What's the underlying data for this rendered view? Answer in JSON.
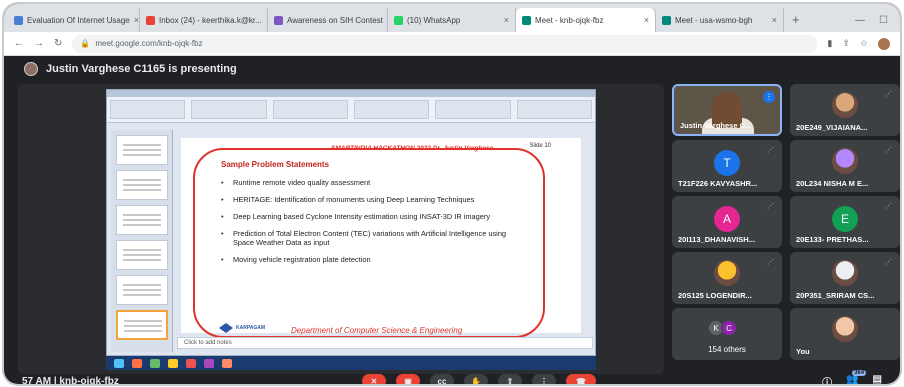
{
  "browser": {
    "tabs": [
      {
        "label": "Evaluation Of Internet Usage",
        "color": "#4a7fd4"
      },
      {
        "label": "Inbox (24) - keerthika.k@kr...",
        "color": "#ea4335"
      },
      {
        "label": "Awareness on SIH Contest",
        "color": "#7e57c2"
      },
      {
        "label": "(10) WhatsApp",
        "color": "#25d366"
      },
      {
        "label": "Meet - knb-ojqk-fbz",
        "color": "#00897b",
        "active": true
      },
      {
        "label": "Meet - usa-wsmo-bgh",
        "color": "#00897b"
      }
    ],
    "new_tab": "+",
    "url": "meet.google.com/knb-ojqk-fbz"
  },
  "meet": {
    "presenting_text": "Justin Varghese C1165 is presenting",
    "meeting_code": "57 AM | knb-ojqk-fbz",
    "participant_count": "364",
    "participants": [
      {
        "name": "Justin Varghese C...",
        "type": "video"
      },
      {
        "name": "20E249_VIJAIANA...",
        "type": "photo",
        "color": "#d9a77a"
      },
      {
        "name": "T21F226 KAVYASHR...",
        "type": "initial",
        "initial": "T",
        "color": "#1a73e8"
      },
      {
        "name": "20L234 NISHA M E...",
        "type": "photo",
        "color": "#b388ff"
      },
      {
        "name": "20I113_DHANAVISH...",
        "type": "initial",
        "initial": "A",
        "color": "#e52592"
      },
      {
        "name": "20E133- PRETHAS...",
        "type": "initial",
        "initial": "E",
        "color": "#12a054"
      },
      {
        "name": "20S125 LOGENDIR...",
        "type": "photo",
        "color": "#fbc02d"
      },
      {
        "name": "20P351_SRIRAM CS...",
        "type": "photo",
        "color": "#eceff1"
      },
      {
        "name": "154 others",
        "type": "others",
        "chips": [
          "K",
          "C"
        ]
      },
      {
        "name": "You",
        "type": "photo",
        "color": "#f0c8a8"
      }
    ]
  },
  "slide": {
    "header": "SMARTINDIA HACKATHON 2022 Dr. Justin Varghese",
    "slide_number": "Slide 10",
    "heading": "Sample Problem Statements",
    "bullets": [
      "Runtime remote video quality assessment",
      "HERITAGE: Identification of monuments using Deep Learning Techniques",
      "Deep Learning based Cyclone Intensity estimation using INSAT-3D IR imagery",
      "Prediction of Total Electron Content (TEC) variations with Artificial Intelligence using Space Weather Data as input",
      "Moving vehicle registration plate detection"
    ],
    "logo_text": "KARPAGAM",
    "footer": "Department of Computer Science & Engineering",
    "notes_placeholder": "Click to add notes"
  }
}
